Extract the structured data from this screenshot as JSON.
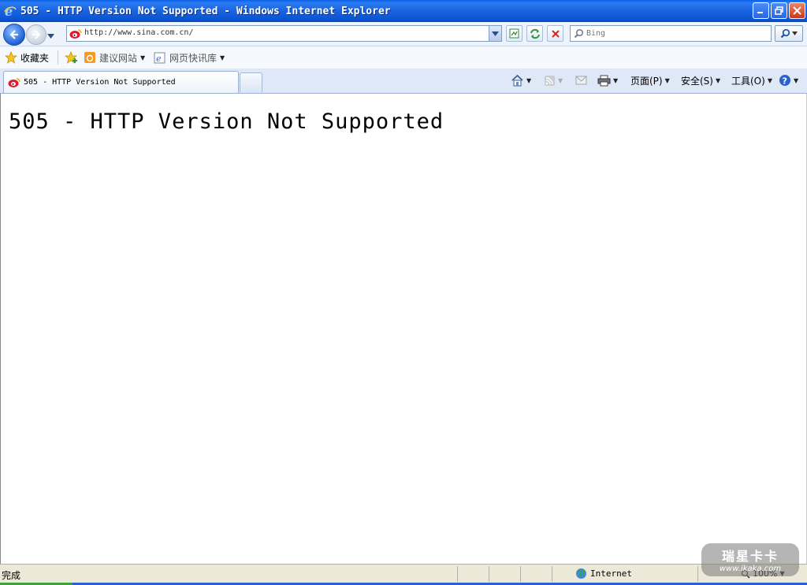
{
  "window": {
    "title": "505 - HTTP Version Not Supported - Windows Internet Explorer"
  },
  "nav": {
    "url": "http://www.sina.com.cn/",
    "search_placeholder": "Bing"
  },
  "favorites_bar": {
    "favorites_label": "收藏夹",
    "suggested_sites_label": "建议网站",
    "web_slice_label": "网页快讯库"
  },
  "tab": {
    "label": "505 - HTTP Version Not Supported"
  },
  "command_bar": {
    "page_label": "页面(P)",
    "safety_label": "安全(S)",
    "tools_label": "工具(O)"
  },
  "content": {
    "heading": "505 - HTTP Version Not Supported"
  },
  "status_bar": {
    "status_text": "完成",
    "zone_label": "Internet",
    "zoom_label": "100%"
  },
  "watermark": {
    "line1": "瑞星卡卡",
    "line2": "www.ikaka.com"
  },
  "colors": {
    "titlebar_blue": "#0c55d2",
    "close_red": "#c8391b",
    "status_bg": "#ece9d8"
  }
}
